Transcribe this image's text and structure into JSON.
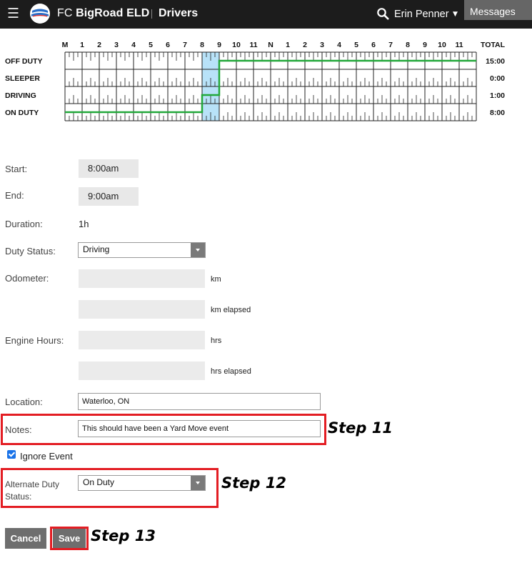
{
  "header": {
    "brand_prefix": "FC",
    "brand_name": "BigRoad ELD",
    "section": "Drivers",
    "user_name": "Erin Penner",
    "messages_label": "Messages"
  },
  "chart_data": {
    "type": "table",
    "hour_labels": [
      "M",
      "1",
      "2",
      "3",
      "4",
      "5",
      "6",
      "7",
      "8",
      "9",
      "10",
      "11",
      "N",
      "1",
      "2",
      "3",
      "4",
      "5",
      "6",
      "7",
      "8",
      "9",
      "10",
      "11"
    ],
    "total_header": "TOTAL",
    "rows": [
      {
        "label": "OFF DUTY",
        "total": "15:00"
      },
      {
        "label": "SLEEPER",
        "total": "0:00"
      },
      {
        "label": "DRIVING",
        "total": "1:00"
      },
      {
        "label": "ON DUTY",
        "total": "8:00"
      }
    ],
    "segments": [
      {
        "status": "ON DUTY",
        "start": 0,
        "end": 8
      },
      {
        "status": "DRIVING",
        "start": 8,
        "end": 9
      },
      {
        "status": "OFF DUTY",
        "start": 9,
        "end": 24
      }
    ],
    "selected_range": [
      8,
      9
    ],
    "line_color": "#22a83a",
    "highlight_color": "#b8e2f8"
  },
  "form": {
    "start_label": "Start:",
    "start_value": "8:00am",
    "end_label": "End:",
    "end_value": "9:00am",
    "duration_label": "Duration:",
    "duration_value": "1h",
    "duty_status_label": "Duty Status:",
    "duty_status_value": "Driving",
    "odometer_label": "Odometer:",
    "odometer_unit": "km",
    "odometer_elapsed_unit": "km elapsed",
    "engine_hours_label": "Engine Hours:",
    "engine_hours_unit": "hrs",
    "engine_hours_elapsed_unit": "hrs elapsed",
    "location_label": "Location:",
    "location_value": "Waterloo, ON",
    "notes_label": "Notes:",
    "notes_value": "This should have been a Yard Move event",
    "ignore_event_label": "Ignore Event",
    "alternate_label_line1": "Alternate Duty",
    "alternate_label_line2": "Status:",
    "alternate_value": "On Duty",
    "cancel_label": "Cancel",
    "save_label": "Save"
  },
  "annotations": {
    "step11": "Step 11",
    "step12": "Step 12",
    "step13": "Step 13",
    "box_color": "#e31d23"
  }
}
